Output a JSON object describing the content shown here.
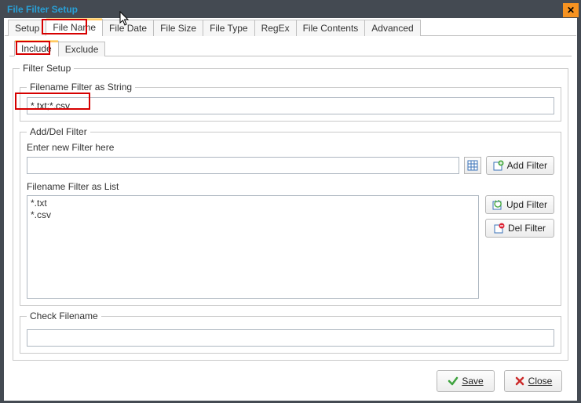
{
  "window": {
    "title": "File Filter Setup",
    "close_label": "×"
  },
  "tabs": [
    {
      "label": "Setup"
    },
    {
      "label": "File Name"
    },
    {
      "label": "File Date"
    },
    {
      "label": "File Size"
    },
    {
      "label": "File Type"
    },
    {
      "label": "RegEx"
    },
    {
      "label": "File Contents"
    },
    {
      "label": "Advanced"
    }
  ],
  "subtabs": [
    {
      "label": "Include"
    },
    {
      "label": "Exclude"
    }
  ],
  "filter_setup": {
    "legend": "Filter Setup",
    "filename_string": {
      "legend": "Filename Filter as String",
      "value": "*.txt;*.csv"
    },
    "add_del": {
      "legend": "Add/Del Filter",
      "enter_label": "Enter new Filter here",
      "enter_value": "",
      "list_legend": "Filename Filter as List",
      "list_items": [
        "*.txt",
        "*.csv"
      ],
      "add_button": "Add Filter",
      "upd_button": "Upd Filter",
      "del_button": "Del Filter"
    },
    "check": {
      "legend": "Check Filename",
      "value": ""
    }
  },
  "dialog_buttons": {
    "save": "Save",
    "close": "Close"
  }
}
